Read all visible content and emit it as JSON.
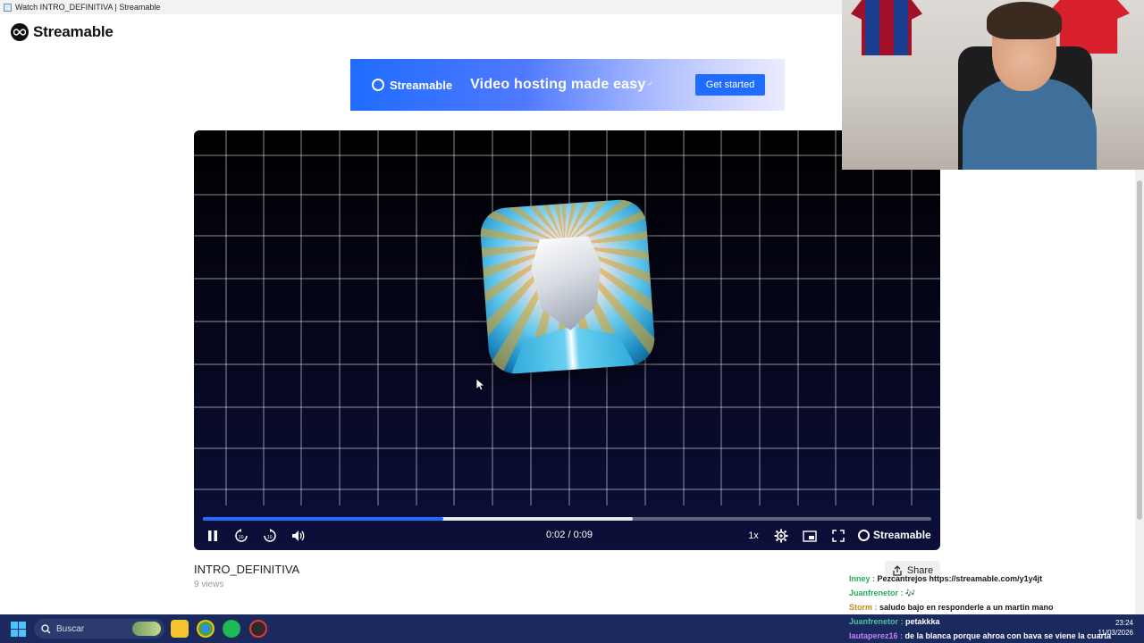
{
  "window": {
    "title": "Watch INTRO_DEFINITIVA | Streamable"
  },
  "header": {
    "logo_text": "Streamable"
  },
  "banner": {
    "brand": "Streamable",
    "tagline": "Video hosting made easy",
    "cta": "Get started"
  },
  "player": {
    "current_time": "0:02",
    "duration": "0:09",
    "time_display": "0:02 / 0:09",
    "played_fraction": 0.33,
    "buffered_fraction": 0.59,
    "speed": "1x",
    "brand": "Streamable",
    "accent_color": "#1f6cff"
  },
  "video": {
    "title": "INTRO_DEFINITIVA",
    "views": "9 views"
  },
  "actions": {
    "share_label": "Share"
  },
  "chat": {
    "lines": [
      {
        "user": "lnney :",
        "message": "Pezcantrejos https://streamable.com/y1y4jt",
        "color": "#27a95a"
      },
      {
        "user": "Juanfrenetor :",
        "message": "🎶",
        "color": "#27a95a"
      },
      {
        "user": "Storm :",
        "message": "saludo bajo en responderle a un martin mano",
        "color": "#c98a1a"
      },
      {
        "user": "Juanfrenetor :",
        "message": "petakkka",
        "color": "#4cc2a0"
      },
      {
        "user": "lautaperez16 :",
        "message": "de la blanca porque ahroa con bava se viene la cuarta",
        "color": "#c77dff"
      }
    ]
  },
  "taskbar": {
    "search_placeholder": "Buscar",
    "time": "23:24",
    "date": "11/03/2026"
  }
}
